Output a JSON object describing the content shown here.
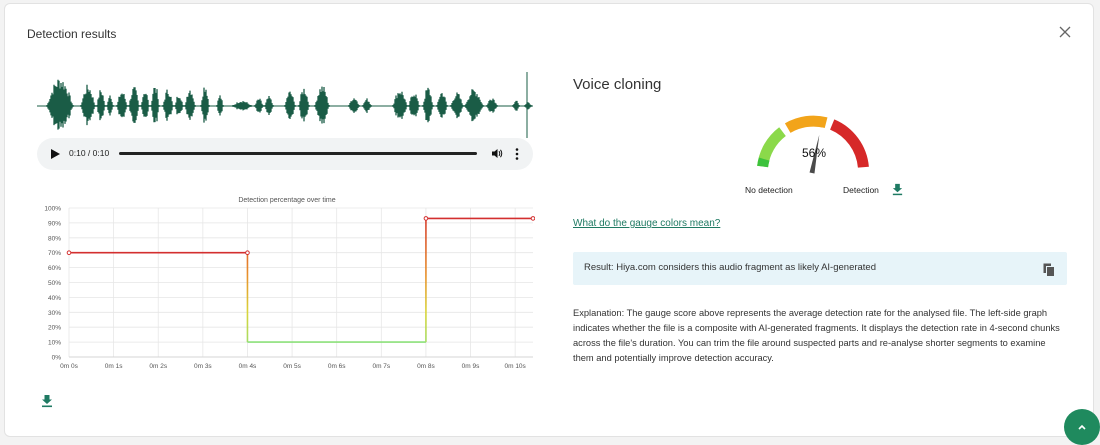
{
  "modal": {
    "title": "Detection results"
  },
  "player": {
    "time": "0:10 / 0:10"
  },
  "voice_cloning": {
    "title": "Voice cloning",
    "gauge_value": "56%",
    "gauge_percent": 56,
    "no_detection_label": "No detection",
    "detection_label": "Detection",
    "gauge_link": "What do the gauge colors mean?"
  },
  "result": {
    "text": "Result: Hiya.com considers this audio fragment as likely AI-generated"
  },
  "explanation": "Explanation: The gauge score above represents the average detection rate for the analysed file. The left-side graph indicates whether the file is a composite with AI-generated fragments. It displays the detection rate in 4-second chunks across the file's duration. You can trim the file around suspected parts and re-analyse shorter segments to examine them and potentially improve detection accuracy.",
  "colors": {
    "accent": "#1f7a63",
    "waveform": "#1a5c46",
    "high": "#d32f2f",
    "low": "#8be07a",
    "fab": "#1f8a5e"
  },
  "chart_data": {
    "type": "line",
    "title": "Detection percentage over time",
    "x": [
      0,
      4,
      4,
      8,
      8,
      10.4
    ],
    "y": [
      70,
      70,
      10,
      10,
      93,
      93
    ],
    "points": [
      [
        0,
        70
      ],
      [
        4,
        70
      ],
      [
        8,
        93
      ],
      [
        10.4,
        93
      ]
    ],
    "xticks": [
      "0m 0s",
      "0m 1s",
      "0m 2s",
      "0m 3s",
      "0m 4s",
      "0m 5s",
      "0m 6s",
      "0m 7s",
      "0m 8s",
      "0m 9s",
      "0m 10s"
    ],
    "yticks": [
      "0%",
      "10%",
      "20%",
      "30%",
      "40%",
      "50%",
      "60%",
      "70%",
      "80%",
      "90%",
      "100%"
    ],
    "xlim": [
      0,
      10.4
    ],
    "ylim": [
      0,
      100
    ],
    "grid": true
  }
}
